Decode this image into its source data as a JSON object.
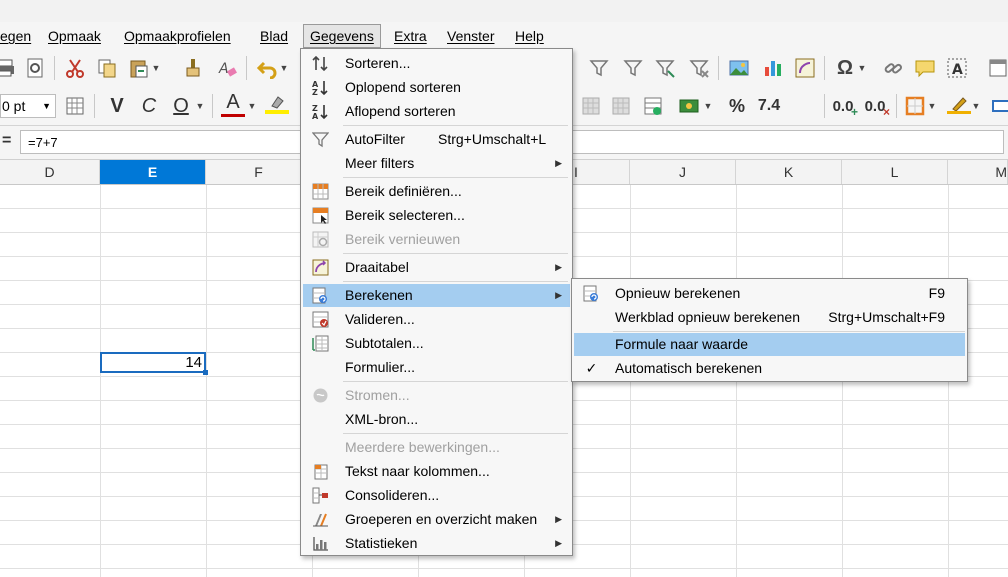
{
  "menubar": {
    "items": [
      "egen",
      "Opmaak",
      "Opmaakprofielen",
      "Blad",
      "Gegevens",
      "Extra",
      "Venster",
      "Help"
    ],
    "active_index": 4
  },
  "toolbar2": {
    "font_size": "0 pt",
    "percent": "%",
    "number_format": "7.4",
    "decimal_add": "0.0",
    "decimal_remove": "0.0",
    "bold": "V",
    "italic": "C",
    "underline": "O",
    "font_color": "A"
  },
  "formula_bar": {
    "equals": "=",
    "value": "=7+7"
  },
  "columns": [
    {
      "label": "D",
      "selected": false
    },
    {
      "label": "E",
      "selected": true
    },
    {
      "label": "F",
      "selected": false
    },
    {
      "label": "",
      "selected": false
    },
    {
      "label": "",
      "selected": false
    },
    {
      "label": "I",
      "selected": false
    },
    {
      "label": "J",
      "selected": false
    },
    {
      "label": "K",
      "selected": false
    },
    {
      "label": "L",
      "selected": false
    },
    {
      "label": "M",
      "selected": false
    }
  ],
  "active_cell": {
    "value": "14"
  },
  "data_menu": {
    "items": [
      {
        "label": "Sorteren...",
        "icon": "sort-icon"
      },
      {
        "label": "Oplopend sorteren",
        "icon": "sort-ascending-icon"
      },
      {
        "label": "Aflopend sorteren",
        "icon": "sort-descending-icon"
      },
      {
        "label": "AutoFilter",
        "shortcut": "Strg+Umschalt+L",
        "icon": "autofilter-icon"
      },
      {
        "label": "Meer filters",
        "submenu": true
      },
      {
        "label": "Bereik definiëren...",
        "icon": "define-range-icon"
      },
      {
        "label": "Bereik selecteren...",
        "icon": "select-range-icon"
      },
      {
        "label": "Bereik vernieuwen",
        "icon": "refresh-range-icon",
        "disabled": true
      },
      {
        "label": "Draaitabel",
        "icon": "pivot-table-icon",
        "submenu": true
      },
      {
        "label": "Berekenen",
        "icon": "calculate-icon",
        "submenu": true,
        "highlighted": true
      },
      {
        "label": "Valideren...",
        "icon": "validate-icon"
      },
      {
        "label": "Subtotalen...",
        "icon": "subtotals-icon"
      },
      {
        "label": "Formulier..."
      },
      {
        "label": "Stromen...",
        "icon": "streams-icon",
        "disabled": true
      },
      {
        "label": "XML-bron..."
      },
      {
        "label": "Meerdere bewerkingen...",
        "disabled": true
      },
      {
        "label": "Tekst naar kolommen...",
        "icon": "text-to-columns-icon"
      },
      {
        "label": "Consolideren...",
        "icon": "consolidate-icon"
      },
      {
        "label": "Groeperen en overzicht maken",
        "icon": "group-outline-icon",
        "submenu": true
      },
      {
        "label": "Statistieken",
        "icon": "statistics-icon",
        "submenu": true
      }
    ]
  },
  "calculate_submenu": {
    "items": [
      {
        "label": "Opnieuw berekenen",
        "shortcut": "F9",
        "icon": "recalculate-icon"
      },
      {
        "label": "Werkblad opnieuw berekenen",
        "shortcut": "Strg+Umschalt+F9"
      },
      {
        "label": "Formule naar waarde",
        "highlighted": true
      },
      {
        "label": "Automatisch berekenen",
        "checked": true
      }
    ]
  },
  "colors": {
    "selection": "#0078d7",
    "menu_highlight": "#a4cdf0",
    "font_color_bar": "#c00000",
    "highlight_bar": "#ffee00"
  }
}
